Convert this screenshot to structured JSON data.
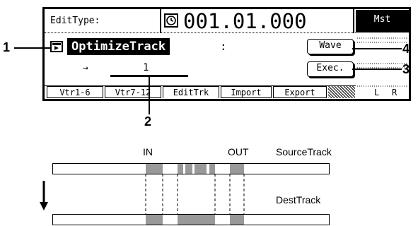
{
  "lcd": {
    "edit_type_label": "EditType:",
    "counter": "001.01.000",
    "mst_label": "Mst",
    "function_name": "OptimizeTrack",
    "separator": ":",
    "wave_button": "Wave",
    "exec_button": "Exec.",
    "arrow": "→",
    "value": "1",
    "tabs": [
      "Vtr1-6",
      "Vtr7-12",
      "EditTrk",
      "Import",
      "Export"
    ],
    "active_tab": "EditTrk",
    "meter_labels": [
      "L",
      "R"
    ]
  },
  "callouts": [
    "1",
    "2",
    "3",
    "4"
  ],
  "diagram": {
    "in_label": "IN",
    "out_label": "OUT",
    "source_track_label": "SourceTrack",
    "dest_track_label": "DestTrack"
  }
}
